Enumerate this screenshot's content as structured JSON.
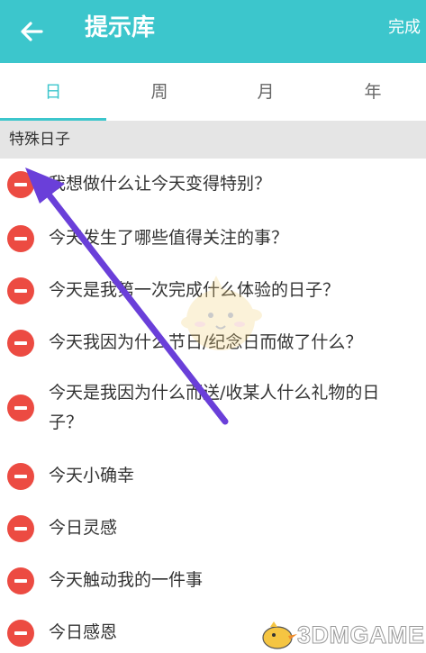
{
  "header": {
    "title": "提示库",
    "done_label": "完成",
    "back_icon": "arrow-left-icon",
    "background": "#3cc6cc"
  },
  "tabs": [
    {
      "label": "日",
      "active": true
    },
    {
      "label": "周",
      "active": false
    },
    {
      "label": "月",
      "active": false
    },
    {
      "label": "年",
      "active": false
    }
  ],
  "section": {
    "title": "特殊日子"
  },
  "items": [
    {
      "text": "我想做什么让今天变得特别？"
    },
    {
      "text": "今天发生了哪些值得关注的事？"
    },
    {
      "text": "今天是我第一次完成什么体验的日子？"
    },
    {
      "text": "今天我因为什么节日/纪念日而做了什么？"
    },
    {
      "text": "今天是我因为什么而送/收某人什么礼物的日子？"
    },
    {
      "text": "今天小确幸"
    },
    {
      "text": "今日灵感"
    },
    {
      "text": "今天触动我的一件事"
    },
    {
      "text": "今日感恩"
    }
  ],
  "watermark": {
    "text": "3DMGAME"
  },
  "colors": {
    "accent": "#3cc6cc",
    "remove": "#ec4b42",
    "annotation_arrow": "#6a3fd9"
  }
}
